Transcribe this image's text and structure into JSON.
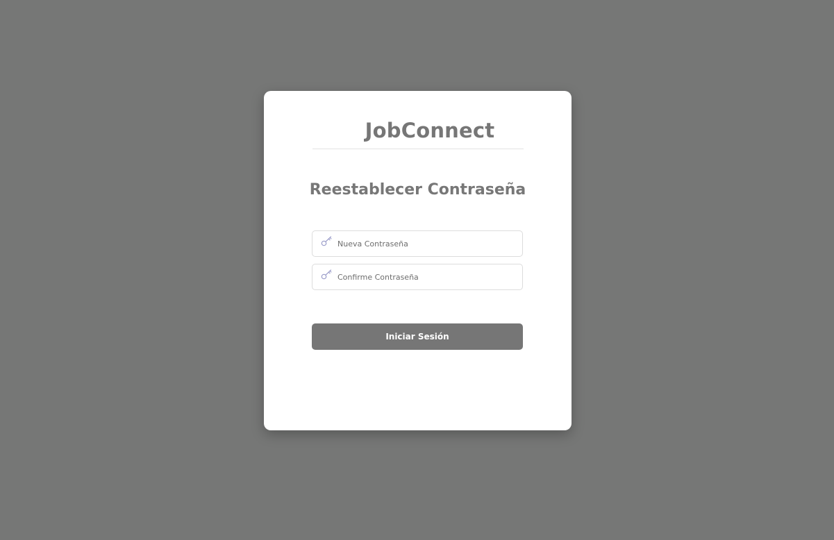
{
  "brand": {
    "name": "JobConnect"
  },
  "form": {
    "title": "Reestablecer Contraseña",
    "new_password": {
      "placeholder": "Nueva Contraseña",
      "value": "",
      "icon": "key-icon"
    },
    "confirm_password": {
      "placeholder": "Confirme Contraseña",
      "value": "",
      "icon": "key-icon"
    },
    "submit_label": "Iniciar Sesión"
  },
  "colors": {
    "background": "#767776",
    "card": "#ffffff",
    "text_primary": "#767676",
    "button": "#767676",
    "icon": "#9a9cc9"
  }
}
